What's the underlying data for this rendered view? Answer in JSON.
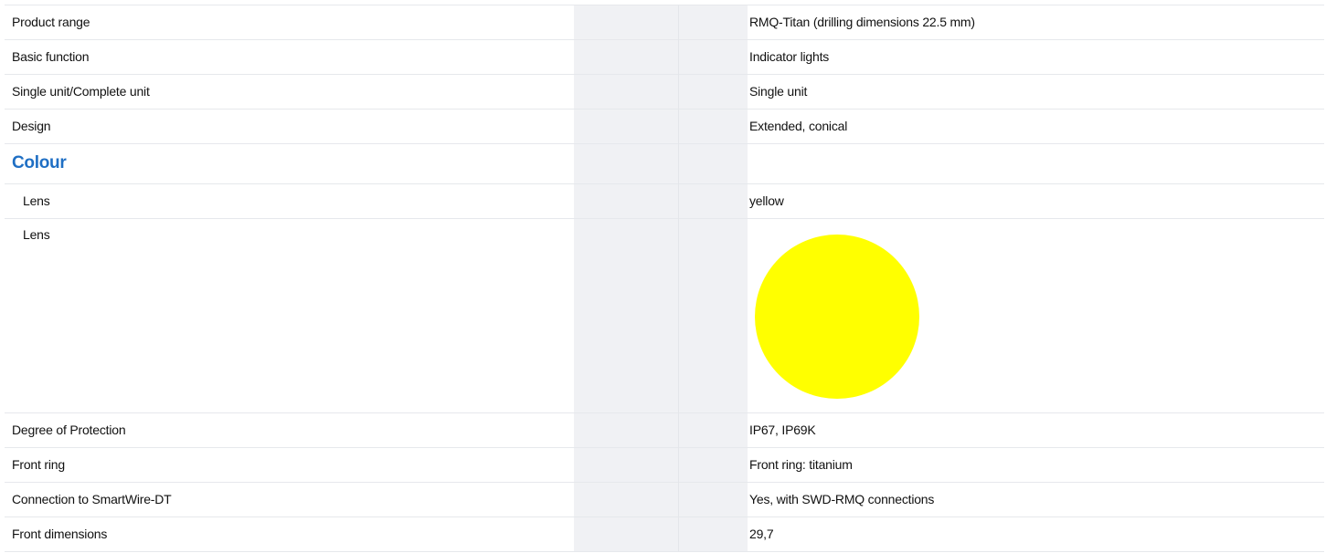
{
  "rows": {
    "product_range": {
      "label": "Product range",
      "value": "RMQ-Titan (drilling dimensions 22.5 mm)"
    },
    "basic_function": {
      "label": "Basic function",
      "value": "Indicator lights"
    },
    "single_complete": {
      "label": "Single unit/Complete unit",
      "value": "Single unit"
    },
    "design": {
      "label": "Design",
      "value": "Extended, conical"
    },
    "colour_section": {
      "title": "Colour"
    },
    "lens_text": {
      "label": "Lens",
      "value": "yellow"
    },
    "lens_swatch": {
      "label": "Lens",
      "swatch_color": "#ffff00"
    },
    "degree_protection": {
      "label": "Degree of Protection",
      "value": "IP67, IP69K"
    },
    "front_ring": {
      "label": "Front ring",
      "value": "Front ring: titanium"
    },
    "smartwire": {
      "label": "Connection to SmartWire-DT",
      "value": "Yes, with SWD-RMQ connections"
    },
    "front_dimensions": {
      "label": "Front dimensions",
      "value": "29,7"
    }
  },
  "colors": {
    "section_title": "#1f6fc4",
    "gap_column": "#f0f1f4",
    "row_divider": "#e6e8ec"
  }
}
